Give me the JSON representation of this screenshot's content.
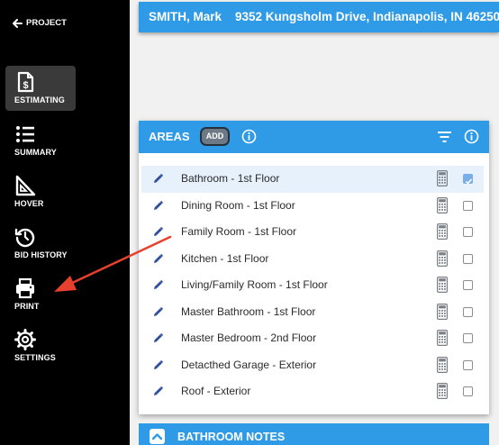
{
  "sidebar": {
    "back_label": "PROJECT",
    "items": [
      {
        "label": "ESTIMATING",
        "icon": "estimate-document-icon",
        "active": true
      },
      {
        "label": "SUMMARY",
        "icon": "list-icon"
      },
      {
        "label": "HOVER",
        "icon": "set-square-icon"
      },
      {
        "label": "BID HISTORY",
        "icon": "history-icon"
      },
      {
        "label": "PRINT",
        "icon": "printer-icon"
      },
      {
        "label": "SETTINGS",
        "icon": "gear-icon"
      }
    ]
  },
  "header": {
    "client": "SMITH, Mark",
    "address": "9352 Kungsholm Drive, Indianapolis, IN 46250"
  },
  "areas": {
    "title": "AREAS",
    "add_label": "ADD",
    "items": [
      {
        "name": "Bathroom - 1st Floor",
        "checked": true
      },
      {
        "name": "Dining Room - 1st Floor",
        "checked": false
      },
      {
        "name": "Family Room - 1st Floor",
        "checked": false
      },
      {
        "name": "Kitchen - 1st Floor",
        "checked": false
      },
      {
        "name": "Living/Family Room - 1st Floor",
        "checked": false
      },
      {
        "name": "Master Bathroom - 1st Floor",
        "checked": false
      },
      {
        "name": "Master Bedroom - 2nd Floor",
        "checked": false
      },
      {
        "name": "Detacthed Garage - Exterior",
        "checked": false
      },
      {
        "name": "Roof - Exterior",
        "checked": false
      }
    ]
  },
  "notes": {
    "title": "BATHROOM NOTES"
  },
  "colors": {
    "accent": "#2f9ae6",
    "sidebar": "#000000",
    "annotation_arrow": "#e8402e",
    "checked": "#7aaeea"
  }
}
